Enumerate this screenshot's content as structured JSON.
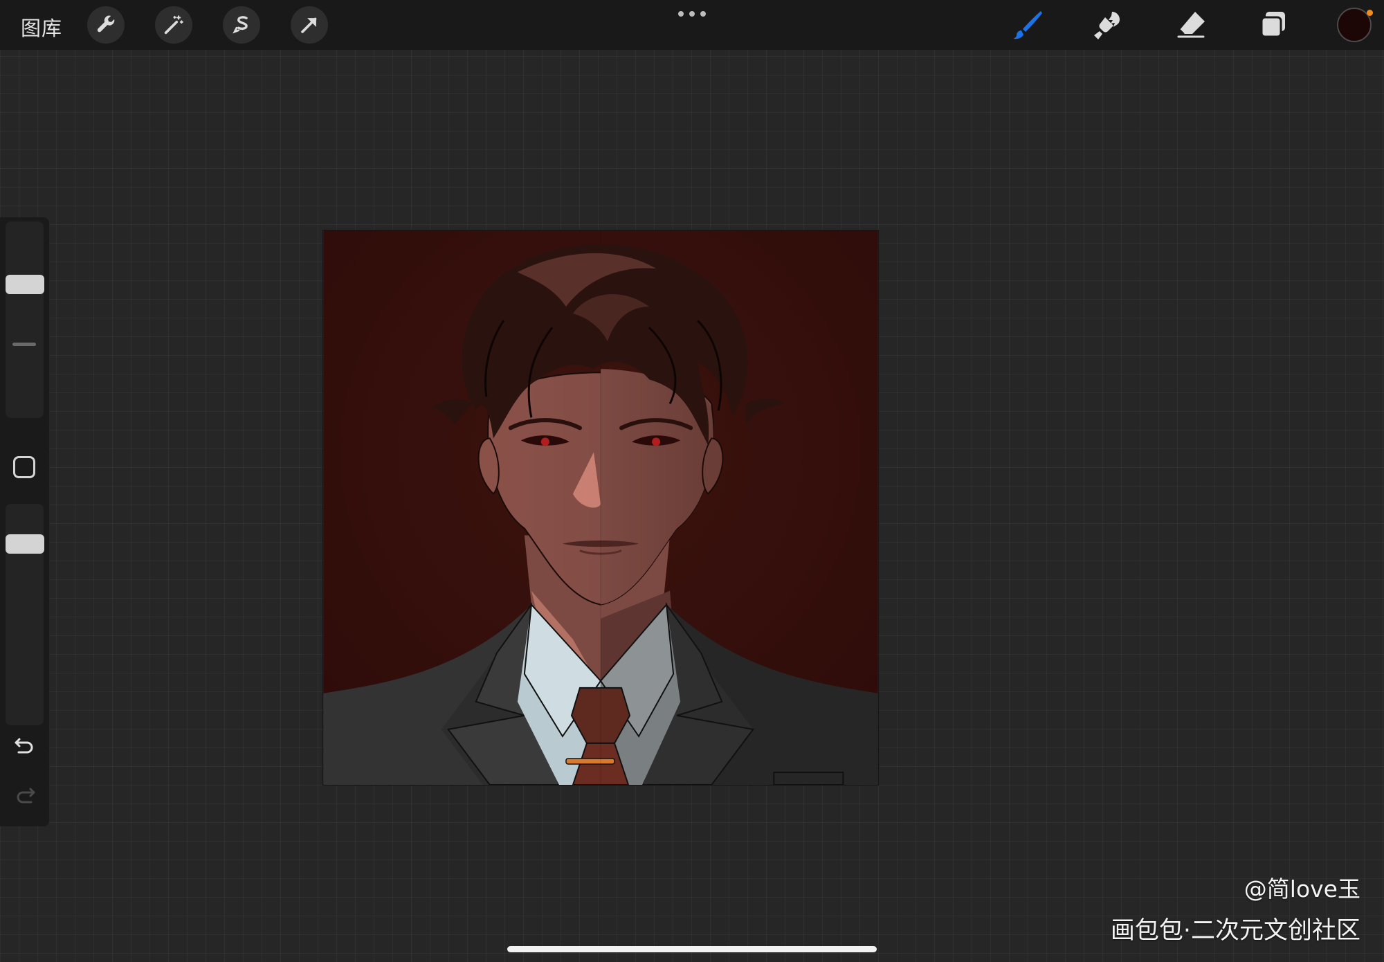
{
  "toolbar": {
    "gallery_label": "图库",
    "left_tools": [
      "wrench-icon",
      "magic-wand-icon",
      "selection-icon",
      "transform-arrow-icon"
    ],
    "right_tools": [
      "brush-icon",
      "smudge-icon",
      "eraser-icon",
      "layers-icon"
    ],
    "active_tool": "brush",
    "accent_color": "#1a73e8"
  },
  "color": {
    "current": "#1d0706",
    "indicator": "#f28c1b"
  },
  "sidebar": {
    "brush_size_level": 0.7,
    "opacity_level": 0.85
  },
  "artwork": {
    "background_color": "#35100c",
    "description_icon": "portrait-artwork"
  },
  "watermark": {
    "user": "@简love玉",
    "site": "画包包·二次元文创社区"
  }
}
